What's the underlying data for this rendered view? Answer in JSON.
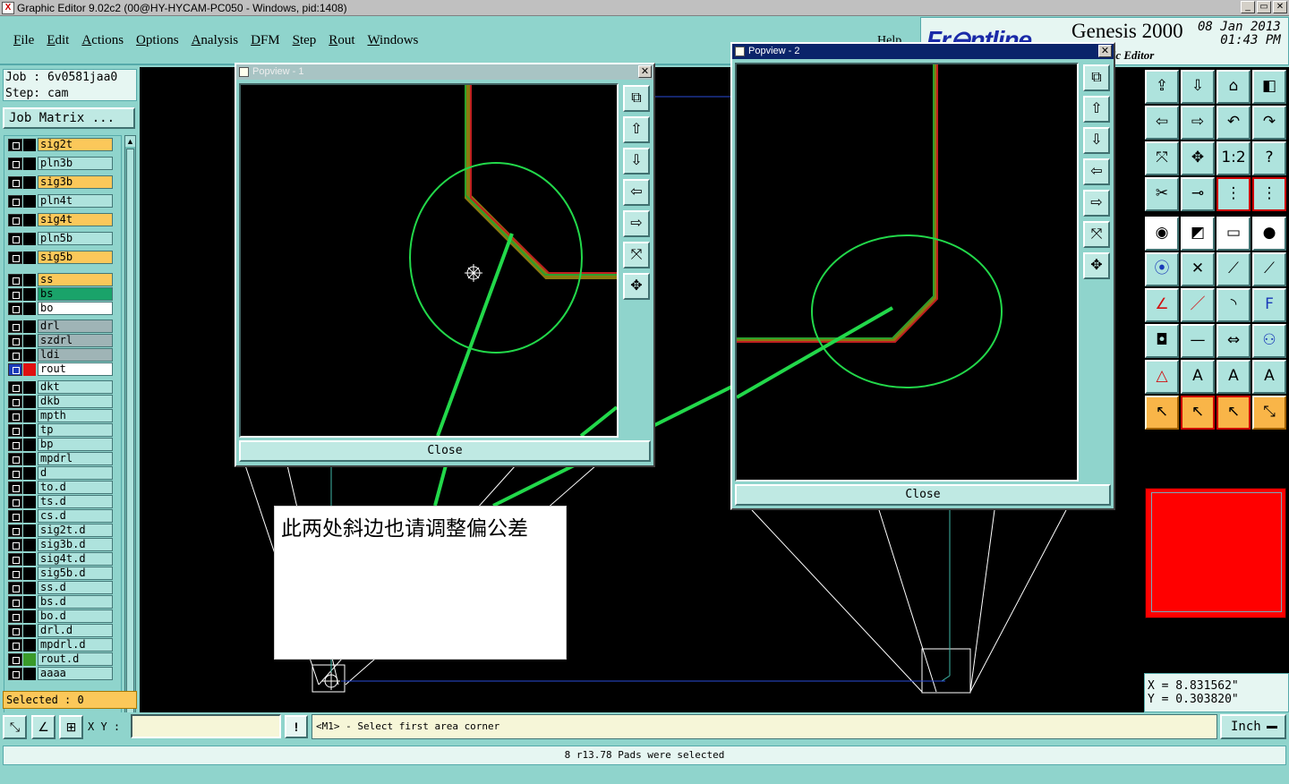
{
  "window": {
    "title": "Graphic Editor 9.02c2 (00@HY-HYCAM-PC050 - Windows, pid:1408)"
  },
  "menu": [
    "File",
    "Edit",
    "Actions",
    "Options",
    "Analysis",
    "DFM",
    "Step",
    "Rout",
    "Windows"
  ],
  "help_label": "Help",
  "logo": {
    "brand": "Fr⊖ntline",
    "product": "Genesis 2000",
    "date": "08 Jan 2013",
    "time": "01:43 PM",
    "subtitle": "phic Editor"
  },
  "job": {
    "job_line": "Job : 6v0581jaa0",
    "step_line": "Step: cam",
    "matrix_label": "Job Matrix ..."
  },
  "layers": [
    {
      "name": "sig2t",
      "color": "#fbc85a"
    },
    {
      "name": "pln3b",
      "color": "#aee3dd"
    },
    {
      "name": "sig3b",
      "color": "#fbc85a"
    },
    {
      "name": "pln4t",
      "color": "#aee3dd"
    },
    {
      "name": "sig4t",
      "color": "#fbc85a"
    },
    {
      "name": "pln5b",
      "color": "#aee3dd"
    },
    {
      "name": "sig5b",
      "color": "#fbc85a"
    },
    {
      "name": "ss",
      "color": "#fbc85a"
    },
    {
      "name": "bs",
      "color": "#1aa36a"
    },
    {
      "name": "bo",
      "color": "#ffffff"
    },
    {
      "name": "drl",
      "color": "#9fb4b6"
    },
    {
      "name": "szdrl",
      "color": "#9fb4b6"
    },
    {
      "name": "ldi",
      "color": "#9fb4b6"
    },
    {
      "name": "rout",
      "color": "#ffffff",
      "active": true
    },
    {
      "name": "dkt",
      "color": "#aee3dd"
    },
    {
      "name": "dkb",
      "color": "#aee3dd"
    },
    {
      "name": "mpth",
      "color": "#aee3dd"
    },
    {
      "name": "tp",
      "color": "#aee3dd"
    },
    {
      "name": "bp",
      "color": "#aee3dd"
    },
    {
      "name": "mpdrl",
      "color": "#aee3dd"
    },
    {
      "name": "d",
      "color": "#aee3dd"
    },
    {
      "name": "to.d",
      "color": "#aee3dd"
    },
    {
      "name": "ts.d",
      "color": "#aee3dd"
    },
    {
      "name": "cs.d",
      "color": "#aee3dd"
    },
    {
      "name": "sig2t.d",
      "color": "#aee3dd"
    },
    {
      "name": "sig3b.d",
      "color": "#aee3dd"
    },
    {
      "name": "sig4t.d",
      "color": "#aee3dd"
    },
    {
      "name": "sig5b.d",
      "color": "#aee3dd"
    },
    {
      "name": "ss.d",
      "color": "#aee3dd"
    },
    {
      "name": "bs.d",
      "color": "#aee3dd"
    },
    {
      "name": "bo.d",
      "color": "#aee3dd"
    },
    {
      "name": "drl.d",
      "color": "#aee3dd"
    },
    {
      "name": "mpdrl.d",
      "color": "#aee3dd"
    },
    {
      "name": "rout.d",
      "color": "#aee3dd",
      "marker": "#3a9a2a"
    },
    {
      "name": "aaaa",
      "color": "#aee3dd"
    }
  ],
  "selected_label": "Selected : 0",
  "popview1": {
    "title": "Popview - 1",
    "close_label": "Close"
  },
  "popview2": {
    "title": "Popview - 2",
    "close_label": "Close"
  },
  "note": "此两处斜边也请调整偏公差",
  "coords": {
    "x_line": "X = 8.831562\"",
    "y_line": "Y = 0.303820\""
  },
  "bottom": {
    "xy_label": "X Y :",
    "xy_value": "",
    "bang_label": "!",
    "prompt": "<M1> - Select first area corner",
    "units": "Inch",
    "status": "8 r13.78 Pads were selected"
  },
  "right_tools": [
    {
      "icon": "layer-up-icon",
      "glyph": "⇪"
    },
    {
      "icon": "layer-down-icon",
      "glyph": "⇩"
    },
    {
      "icon": "home-icon",
      "glyph": "⌂"
    },
    {
      "icon": "split-view-icon",
      "glyph": "◧"
    },
    {
      "icon": "move-left-icon",
      "glyph": "⇦"
    },
    {
      "icon": "move-right-icon",
      "glyph": "⇨"
    },
    {
      "icon": "undo-icon",
      "glyph": "↶"
    },
    {
      "icon": "redo-icon",
      "glyph": "↷"
    },
    {
      "icon": "zoom-fit-icon",
      "glyph": "⤧"
    },
    {
      "icon": "zoom-center-icon",
      "glyph": "✥"
    },
    {
      "icon": "scale-icon",
      "glyph": "1:2"
    },
    {
      "icon": "help-icon",
      "glyph": "?"
    },
    {
      "icon": "tools-icon",
      "glyph": "✂"
    },
    {
      "icon": "measure-icon",
      "glyph": "⊸"
    },
    {
      "icon": "net-icon",
      "glyph": "⋮"
    },
    {
      "icon": "net2-icon",
      "glyph": "⋮"
    },
    {
      "icon": "add-pad-icon",
      "glyph": "◉"
    },
    {
      "icon": "add-line-icon",
      "glyph": "◩"
    },
    {
      "icon": "ruler-icon",
      "glyph": "▭"
    },
    {
      "icon": "circle-icon",
      "glyph": "●"
    },
    {
      "icon": "connect-icon",
      "glyph": "⦿"
    },
    {
      "icon": "cross-icon",
      "glyph": "✕"
    },
    {
      "icon": "segment-icon",
      "glyph": "⟋"
    },
    {
      "icon": "segment2-icon",
      "glyph": "⟋"
    },
    {
      "icon": "angle-icon",
      "glyph": "∠"
    },
    {
      "icon": "line-icon",
      "glyph": "／"
    },
    {
      "icon": "arc-icon",
      "glyph": "◝"
    },
    {
      "icon": "text-icon",
      "glyph": "F"
    },
    {
      "icon": "pad-icon",
      "glyph": "◘"
    },
    {
      "icon": "minus-icon",
      "glyph": "—"
    },
    {
      "icon": "resize-icon",
      "glyph": "⇔"
    },
    {
      "icon": "cluster-icon",
      "glyph": "⚇"
    },
    {
      "icon": "triangle-icon",
      "glyph": "△"
    },
    {
      "icon": "a-icon",
      "glyph": "A"
    },
    {
      "icon": "a-bold-icon",
      "glyph": "A"
    },
    {
      "icon": "a-strike-icon",
      "glyph": "A"
    },
    {
      "icon": "select-icon",
      "glyph": "↖"
    },
    {
      "icon": "select-box-icon",
      "glyph": "↖"
    },
    {
      "icon": "select-hl-icon",
      "glyph": "↖"
    },
    {
      "icon": "route-icon",
      "glyph": "⤡"
    }
  ]
}
